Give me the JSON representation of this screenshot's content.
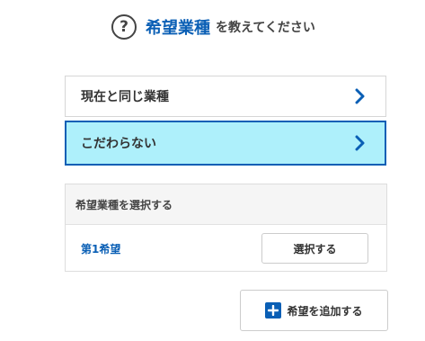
{
  "header": {
    "icon": "question-circle-icon",
    "icon_glyph": "?",
    "title_accent": "希望業種",
    "title_rest": "を教えてください"
  },
  "options": [
    {
      "label": "現在と同じ業種",
      "selected": false,
      "icon": "chevron-right-icon"
    },
    {
      "label": "こだわらない",
      "selected": true,
      "icon": "chevron-right-icon"
    }
  ],
  "panel": {
    "heading": "希望業種を選択する",
    "rows": [
      {
        "label": "第1希望",
        "button_label": "選択する"
      }
    ]
  },
  "add_button": {
    "label": "希望を追加する",
    "icon": "plus-icon"
  },
  "colors": {
    "accent": "#0a5fb5",
    "selected_bg": "#aef0fb",
    "border": "#d6d6d6",
    "panel_head_bg": "#f5f5f5"
  }
}
